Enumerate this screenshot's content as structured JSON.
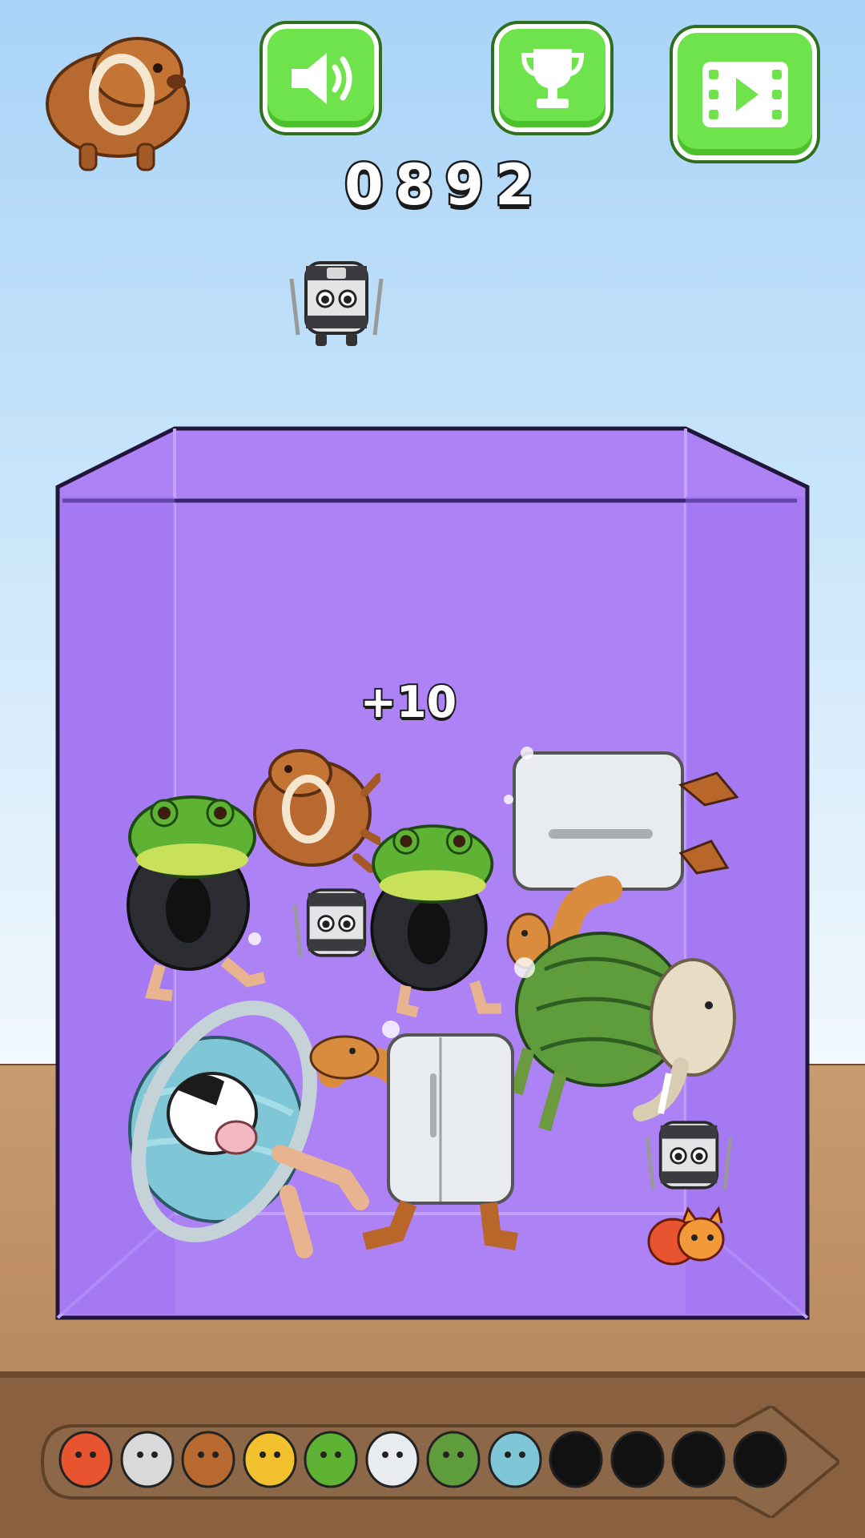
{
  "score": {
    "value": "0892"
  },
  "popup": {
    "text": "+10"
  },
  "buttons": {
    "sound": {
      "icon": "speaker-icon"
    },
    "trophy": {
      "icon": "trophy-icon"
    },
    "video": {
      "icon": "video-play-icon"
    }
  },
  "player": {
    "icon": "capybara-icon"
  },
  "next_drop": {
    "icon": "ninja-pot-icon"
  },
  "container_color": "#ad82f5",
  "progression": {
    "items": [
      {
        "name": "cat-crab",
        "unlocked": true
      },
      {
        "name": "ninja-pot",
        "unlocked": true
      },
      {
        "name": "capybara",
        "unlocked": true
      },
      {
        "name": "monkey-banana",
        "unlocked": true
      },
      {
        "name": "frog-tire",
        "unlocked": true
      },
      {
        "name": "camel-fridge",
        "unlocked": true
      },
      {
        "name": "cactus-elephant",
        "unlocked": true
      },
      {
        "name": "cow-planet",
        "unlocked": true
      },
      {
        "name": "locked-1",
        "unlocked": false
      },
      {
        "name": "locked-2",
        "unlocked": false
      },
      {
        "name": "locked-3",
        "unlocked": false
      },
      {
        "name": "locked-4",
        "unlocked": false
      }
    ]
  }
}
